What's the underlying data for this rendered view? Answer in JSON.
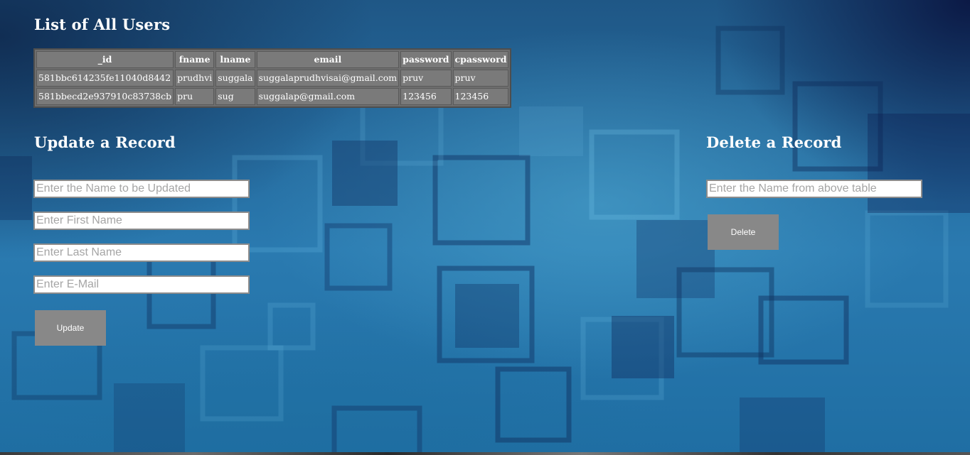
{
  "users_section": {
    "title": "List of All Users",
    "columns": [
      "_id",
      "fname",
      "lname",
      "email",
      "password",
      "cpassword"
    ],
    "rows": [
      [
        "581bbc614235fe11040d8442",
        "prudhvi",
        "suggala",
        "suggalaprudhvisai@gmail.com",
        "pruv",
        "pruv"
      ],
      [
        "581bbecd2e937910c83738cb",
        "pru",
        "sug",
        "suggalap@gmail.com",
        "123456",
        "123456"
      ]
    ]
  },
  "update_section": {
    "title": "Update a Record",
    "name_placeholder": "Enter the Name to be Updated",
    "first_name_placeholder": "Enter First Name",
    "last_name_placeholder": "Enter Last Name",
    "email_placeholder": "Enter E-Mail",
    "button_label": "Update"
  },
  "delete_section": {
    "title": "Delete a Record",
    "name_placeholder": "Enter the Name from above table",
    "button_label": "Delete"
  },
  "colors": {
    "background": "#1d5f93",
    "table_cell": "#7a7a7a",
    "button": "#888888",
    "text": "#ffffff"
  }
}
